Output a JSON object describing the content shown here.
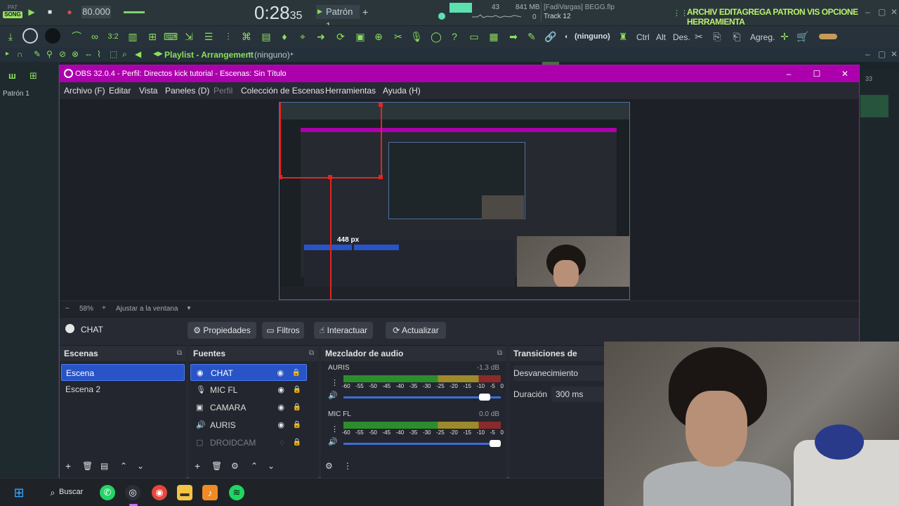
{
  "fl": {
    "song_mode_small": "PAT",
    "song_mode": "SONG",
    "tempo": "80.000",
    "time_main": "0:28",
    "time_sec": "35",
    "pattern": "Patrón 1",
    "cpu_num": "43",
    "mem": "841 MB",
    "mem_sub": "0",
    "project": "[FadiVargas] BEGG.flp",
    "track": "Track 12",
    "app_title": "ARCHIV EDITAGREGA PATRON VIS OPCIONE HERRAMIENTA",
    "tb2_ninguno": "(ninguno)",
    "tb2_ctrl": "Ctrl",
    "tb2_alt": "Alt",
    "tb2_des": "Des.",
    "tb2_agreg": "Agreg.",
    "playlist_label": "Playlist - Arrangement",
    "playlist_sub": "(ninguno)",
    "patron_left": "Patrón 1",
    "right_num": "33"
  },
  "obs": {
    "title": "OBS 32.0.4 - Perfil: Directos kick tutorial - Escenas: Sin Título",
    "menu": [
      "Archivo (F)",
      "Editar",
      "Vista",
      "Paneles (D)",
      "Perfil",
      "Colección de Escenas",
      "Herramientas",
      "Ayuda (H)"
    ],
    "preview_px": "448 px",
    "zoom": "58%",
    "fit": "Ajustar a la ventana",
    "source_name": "CHAT",
    "btn_props": "Propiedades",
    "btn_filters": "Filtros",
    "btn_interact": "Interactuar",
    "btn_refresh": "Actualizar",
    "scenes_title": "Escenas",
    "scenes": [
      "Escena",
      "Escena 2"
    ],
    "sources_title": "Fuentes",
    "sources": [
      "CHAT",
      "MIC FL",
      "CAMARA",
      "AURIS",
      "DROIDCAM"
    ],
    "mixer_title": "Mezclador de audio",
    "mixer": [
      {
        "name": "AURIS",
        "db": "-1.3 dB",
        "level": 0.93
      },
      {
        "name": "MIC FL",
        "db": "0.0 dB",
        "level": 1.0
      }
    ],
    "meter_scale": [
      "-60",
      "-55",
      "-50",
      "-45",
      "-40",
      "-35",
      "-30",
      "-25",
      "-20",
      "-15",
      "-10",
      "-5",
      "0"
    ],
    "transitions_title": "Transiciones de escena",
    "transition": "Desvanecimiento",
    "duration_label": "Duración",
    "duration": "300 ms"
  },
  "taskbar": {
    "search": "Buscar"
  },
  "colors": {
    "obs_title": "#ad00ad",
    "selection": "#2854c8",
    "fl_green": "#8de05c"
  }
}
